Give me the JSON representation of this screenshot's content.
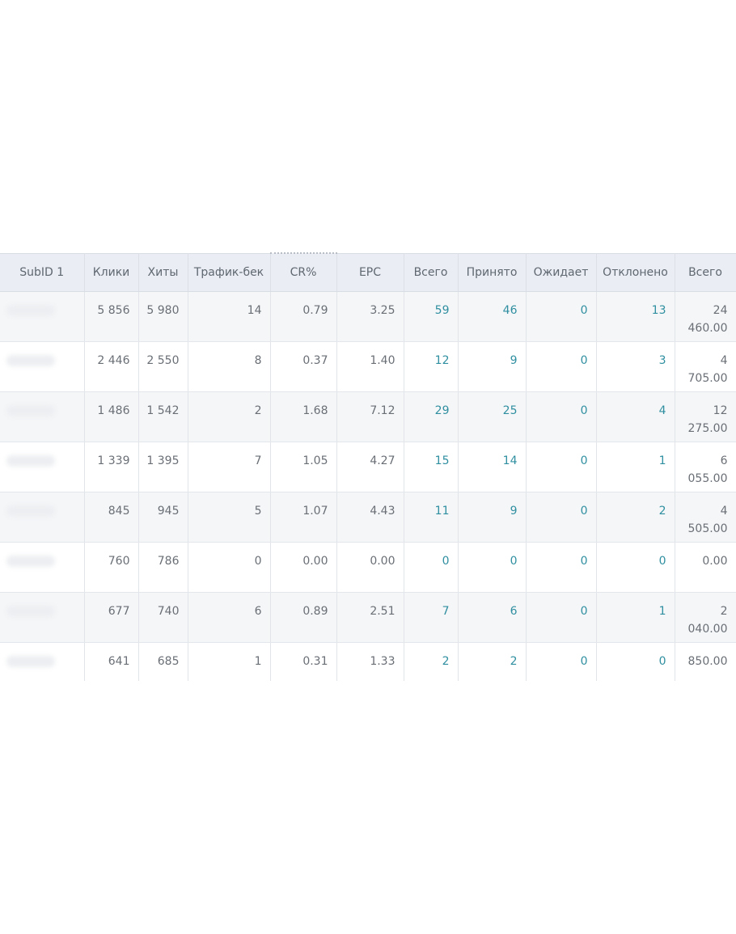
{
  "table": {
    "headers": [
      "SubID 1",
      "Клики",
      "Хиты",
      "Трафик-бек",
      "CR%",
      "EPC",
      "Всего",
      "Принято",
      "Ожидает",
      "Отклонено",
      "Всего"
    ],
    "rows": [
      {
        "subid": "",
        "clicks": "5 856",
        "hits": "5 980",
        "trafficback": "14",
        "cr": "0.79",
        "epc": "3.25",
        "total": "59",
        "accepted": "46",
        "pending": "0",
        "rejected": "13",
        "sum": "24 460.00"
      },
      {
        "subid": "",
        "clicks": "2 446",
        "hits": "2 550",
        "trafficback": "8",
        "cr": "0.37",
        "epc": "1.40",
        "total": "12",
        "accepted": "9",
        "pending": "0",
        "rejected": "3",
        "sum": "4 705.00"
      },
      {
        "subid": "",
        "clicks": "1 486",
        "hits": "1 542",
        "trafficback": "2",
        "cr": "1.68",
        "epc": "7.12",
        "total": "29",
        "accepted": "25",
        "pending": "0",
        "rejected": "4",
        "sum": "12 275.00"
      },
      {
        "subid": "",
        "clicks": "1 339",
        "hits": "1 395",
        "trafficback": "7",
        "cr": "1.05",
        "epc": "4.27",
        "total": "15",
        "accepted": "14",
        "pending": "0",
        "rejected": "1",
        "sum": "6 055.00"
      },
      {
        "subid": "",
        "clicks": "845",
        "hits": "945",
        "trafficback": "5",
        "cr": "1.07",
        "epc": "4.43",
        "total": "11",
        "accepted": "9",
        "pending": "0",
        "rejected": "2",
        "sum": "4 505.00"
      },
      {
        "subid": "",
        "clicks": "760",
        "hits": "786",
        "trafficback": "0",
        "cr": "0.00",
        "epc": "0.00",
        "total": "0",
        "accepted": "0",
        "pending": "0",
        "rejected": "0",
        "sum": "0.00"
      },
      {
        "subid": "",
        "clicks": "677",
        "hits": "740",
        "trafficback": "6",
        "cr": "0.89",
        "epc": "2.51",
        "total": "7",
        "accepted": "6",
        "pending": "0",
        "rejected": "1",
        "sum": "2 040.00"
      },
      {
        "subid": "",
        "clicks": "641",
        "hits": "685",
        "trafficback": "1",
        "cr": "0.31",
        "epc": "1.33",
        "total": "2",
        "accepted": "2",
        "pending": "0",
        "rejected": "0",
        "sum": "850.00"
      }
    ]
  },
  "colors": {
    "link": "#2f8fa0",
    "header_bg": "#eaedf3",
    "text": "#6a6f76"
  }
}
